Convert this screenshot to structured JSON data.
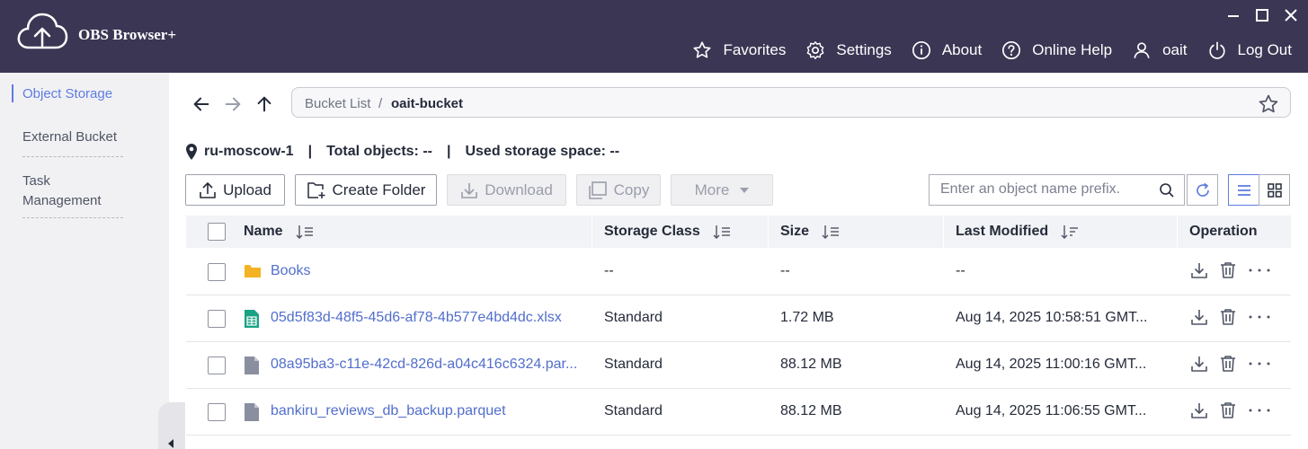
{
  "app": {
    "title": "OBS Browser+"
  },
  "top_nav": [
    {
      "label": "Favorites",
      "icon": "star-icon"
    },
    {
      "label": "Settings",
      "icon": "gear-icon"
    },
    {
      "label": "About",
      "icon": "info-icon"
    },
    {
      "label": "Online Help",
      "icon": "help-icon"
    },
    {
      "label": "oait",
      "icon": "user-icon"
    },
    {
      "label": "Log Out",
      "icon": "power-icon"
    }
  ],
  "sidebar": {
    "items": [
      {
        "label": "Object Storage",
        "active": true
      },
      {
        "label": "External Bucket",
        "active": false
      },
      {
        "label": "Task Management",
        "active": false
      }
    ]
  },
  "breadcrumb": {
    "root": "Bucket List",
    "separator": "/",
    "bucket": "oait-bucket"
  },
  "info": {
    "region": "ru-moscow-1",
    "separator": "|",
    "total_objects": "Total objects: --",
    "used_storage": "Used storage space: --"
  },
  "toolbar": {
    "upload": "Upload",
    "create_folder": "Create Folder",
    "download": "Download",
    "copy": "Copy",
    "more": "More",
    "search_placeholder": "Enter an object name prefix."
  },
  "table": {
    "columns": [
      "Name",
      "Storage Class",
      "Size",
      "Last Modified",
      "Operation"
    ],
    "rows": [
      {
        "name": "Books",
        "type": "folder",
        "storage_class": "--",
        "size": "--",
        "last_modified": "--"
      },
      {
        "name": "05d5f83d-48f5-45d6-af78-4b577e4bd4dc.xlsx",
        "type": "spreadsheet",
        "storage_class": "Standard",
        "size": "1.72 MB",
        "last_modified": "Aug 14, 2025 10:58:51 GMT..."
      },
      {
        "name": "08a95ba3-c11e-42cd-826d-a04c416c6324.par...",
        "type": "file",
        "storage_class": "Standard",
        "size": "88.12 MB",
        "last_modified": "Aug 14, 2025 11:00:16 GMT..."
      },
      {
        "name": "bankiru_reviews_db_backup.parquet",
        "type": "file",
        "storage_class": "Standard",
        "size": "88.12 MB",
        "last_modified": "Aug 14, 2025 11:06:55 GMT..."
      }
    ],
    "ellipsis": "···"
  },
  "colors": {
    "header_bg": "#3b3654",
    "sidebar_bg": "#f1f1f4",
    "accent": "#5e7ce0",
    "link": "#526ecc",
    "folder": "#f3b324",
    "spreadsheet": "#1aa385",
    "file": "#8a8fa0"
  }
}
